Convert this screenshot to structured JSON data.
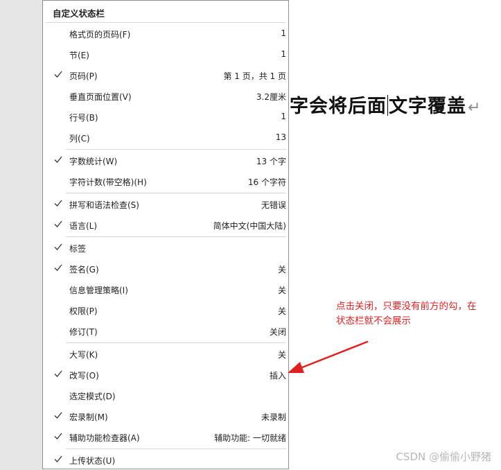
{
  "document": {
    "text_before_cursor": "字会将后面",
    "text_after_cursor": "文字覆盖",
    "paragraph_mark": "↵"
  },
  "menu": {
    "title": "自定义状态栏",
    "items": [
      {
        "label": "格式页的页码(F)",
        "value": "1",
        "checked": false
      },
      {
        "label": "节(E)",
        "value": "1",
        "checked": false
      },
      {
        "label": "页码(P)",
        "value": "第 1 页，共 1 页",
        "checked": true
      },
      {
        "label": "垂直页面位置(V)",
        "value": "3.2厘米",
        "checked": false
      },
      {
        "label": "行号(B)",
        "value": "1",
        "checked": false
      },
      {
        "label": "列(C)",
        "value": "13",
        "checked": false
      },
      {
        "label": "字数统计(W)",
        "value": "13 个字",
        "checked": true
      },
      {
        "label": "字符计数(带空格)(H)",
        "value": "16 个字符",
        "checked": false
      },
      {
        "label": "拼写和语法检查(S)",
        "value": "无错误",
        "checked": true
      },
      {
        "label": "语言(L)",
        "value": "简体中文(中国大陆)",
        "checked": true
      },
      {
        "label": "标签",
        "value": "",
        "checked": true
      },
      {
        "label": "签名(G)",
        "value": "关",
        "checked": true
      },
      {
        "label": "信息管理策略(I)",
        "value": "关",
        "checked": false
      },
      {
        "label": "权限(P)",
        "value": "关",
        "checked": false
      },
      {
        "label": "修订(T)",
        "value": "关闭",
        "checked": false
      },
      {
        "label": "大写(K)",
        "value": "关",
        "checked": false
      },
      {
        "label": "改写(O)",
        "value": "插入",
        "checked": true
      },
      {
        "label": "选定模式(D)",
        "value": "",
        "checked": false
      },
      {
        "label": "宏录制(M)",
        "value": "未录制",
        "checked": true
      },
      {
        "label": "辅助功能检查器(A)",
        "value": "辅助功能: 一切就绪",
        "checked": true
      },
      {
        "label": "上传状态(U)",
        "value": "",
        "checked": true
      }
    ]
  },
  "annotation": {
    "text": "点击关闭，只要没有前方的勾，在状态栏就不会展示",
    "color": "#e02020"
  },
  "watermark": "CSDN @偷偷小野猪"
}
